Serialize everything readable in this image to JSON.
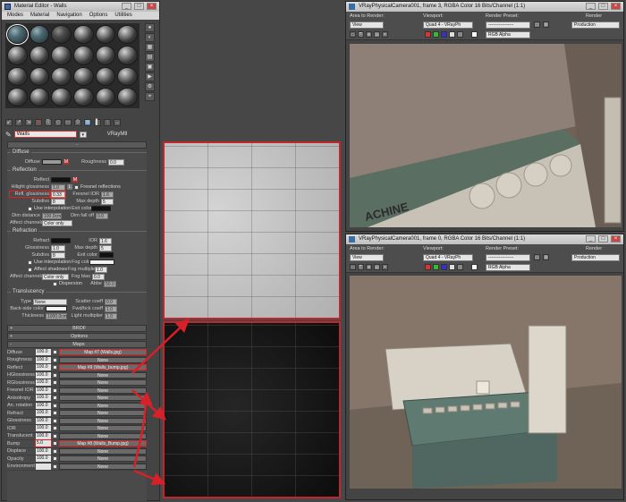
{
  "material_editor": {
    "title": "Material Editor - Walls",
    "menu": [
      "Modes",
      "Material",
      "Navigation",
      "Options",
      "Utilities"
    ],
    "material_name": "Walls",
    "material_type": "VRayMtl",
    "diffuse": {
      "title": "Diffuse",
      "diffuse_label": "Diffuse",
      "roughness_label": "Roughness",
      "roughness_val": "0.0",
      "m": "M"
    },
    "reflection": {
      "title": "Reflection",
      "reflect": "Reflect",
      "hilight": "Hilight glossiness",
      "hilight_val": "1.0",
      "l": "L",
      "refl_gloss": "Refl. glossiness",
      "refl_gloss_val": "0.33",
      "subdivs": "Subdivs",
      "subdivs_val": "8",
      "use_interp": "Use interpolation",
      "dim_dist": "Dim distance",
      "dim_dist_val": "100.0cm",
      "affect_ch": "Affect channels",
      "color_only": "Color only",
      "fresnel": "Fresnel reflections",
      "fresnel_ior": "Fresnel IOR",
      "fresnel_ior_val": "1.6",
      "max_depth": "Max depth",
      "max_depth_val": "5",
      "exit_color": "Exit color",
      "dim_falloff": "Dim fall off",
      "dim_falloff_val": "0.0"
    },
    "refraction": {
      "title": "Refraction",
      "refract": "Refract",
      "ior": "IOR",
      "ior_val": "1.6",
      "glossiness": "Glossiness",
      "gloss_val": "1.0",
      "max_depth": "Max depth",
      "max_depth_val": "5",
      "subdivs": "Subdivs",
      "subdivs_val": "8",
      "exit_color": "Exit color",
      "use_interp": "Use interpolation",
      "fog_color": "Fog color",
      "affect_shadows": "Affect shadows",
      "fog_mult": "Fog multiplier",
      "fog_mult_val": "1.0",
      "affect_ch": "Affect channels",
      "color_only": "Color only",
      "fog_bias": "Fog bias",
      "fog_bias_val": "0.0",
      "dispersion": "Dispersion",
      "abbe": "Abbe",
      "abbe_val": "50.0"
    },
    "translucency": {
      "title": "Translucency",
      "type": "Type",
      "type_val": "None",
      "scatter": "Scatter coeff",
      "scatter_val": "0.0",
      "backside": "Back-side color",
      "fwd": "Fwd/bck coeff",
      "fwd_val": "1.0",
      "thickness": "Thickness",
      "thickness_val": "1000.0cm",
      "light_mult": "Light multiplier",
      "light_mult_val": "1.0"
    },
    "rollouts": [
      "BRDF",
      "Options",
      "Maps"
    ],
    "maps": [
      {
        "name": "Diffuse",
        "val": "100.0",
        "map": "Map #7 (Walls.jpg)",
        "hl": true,
        "hlval": false
      },
      {
        "name": "Roughness",
        "val": "100.0",
        "map": "None",
        "hl": false,
        "hlval": false
      },
      {
        "name": "Reflect",
        "val": "100.0",
        "map": "Map #9 (Walls_bump.jpg)",
        "hl": true,
        "hlval": false
      },
      {
        "name": "HGlossiness",
        "val": "100.0",
        "map": "None",
        "hl": false,
        "hlval": false
      },
      {
        "name": "RGlossiness",
        "val": "100.0",
        "map": "None",
        "hl": false,
        "hlval": false
      },
      {
        "name": "Fresnel IOR",
        "val": "100.0",
        "map": "None",
        "hl": false,
        "hlval": false
      },
      {
        "name": "Anisotropy",
        "val": "100.0",
        "map": "None",
        "hl": false,
        "hlval": false
      },
      {
        "name": "An. rotation",
        "val": "100.0",
        "map": "None",
        "hl": false,
        "hlval": false
      },
      {
        "name": "Refract",
        "val": "100.0",
        "map": "None",
        "hl": false,
        "hlval": false
      },
      {
        "name": "Glossiness",
        "val": "100.0",
        "map": "None",
        "hl": false,
        "hlval": false
      },
      {
        "name": "IOR",
        "val": "100.0",
        "map": "None",
        "hl": false,
        "hlval": false
      },
      {
        "name": "Translucent",
        "val": "100.0",
        "map": "None",
        "hl": false,
        "hlval": false
      },
      {
        "name": "Bump",
        "val": "5.0",
        "map": "Map #8 (Walls_Bump.jpg)",
        "hl": true,
        "hlval": true
      },
      {
        "name": "Displace",
        "val": "100.0",
        "map": "None",
        "hl": false,
        "hlval": false
      },
      {
        "name": "Opacity",
        "val": "100.0",
        "map": "None",
        "hl": false,
        "hlval": false
      },
      {
        "name": "Environment",
        "val": "",
        "map": "None",
        "hl": false,
        "hlval": false
      }
    ]
  },
  "frame_top": {
    "title": "VRayPhysicalCamera001, frame 3, RGBA Color 16 Bits/Channel (1:1)",
    "area_label": "Area to Render:",
    "area_val": "View",
    "viewport_label": "Viewport:",
    "viewport_val": "Quad 4 - VRayPh",
    "preset_label": "Render Preset:",
    "preset_val": "-----------------",
    "render_label": "Render",
    "render_val": "Production",
    "channel_val": "RGB Alpha",
    "scene_text": "ACHINE"
  },
  "frame_bottom": {
    "title": "VRayPhysicalCamera001, frame 0, RGBA Color 16 Bits/Channel (1:1)",
    "area_label": "Area to Render:",
    "area_val": "View",
    "viewport_label": "Viewport:",
    "viewport_val": "Quad 4 - VRayPh",
    "preset_label": "Render Preset:",
    "preset_val": "-----------------",
    "render_label": "Render",
    "render_val": "Production",
    "channel_val": "RGB Alpha"
  },
  "colors": {
    "highlight": "#c0272d",
    "accent": "#3a6ea5"
  }
}
